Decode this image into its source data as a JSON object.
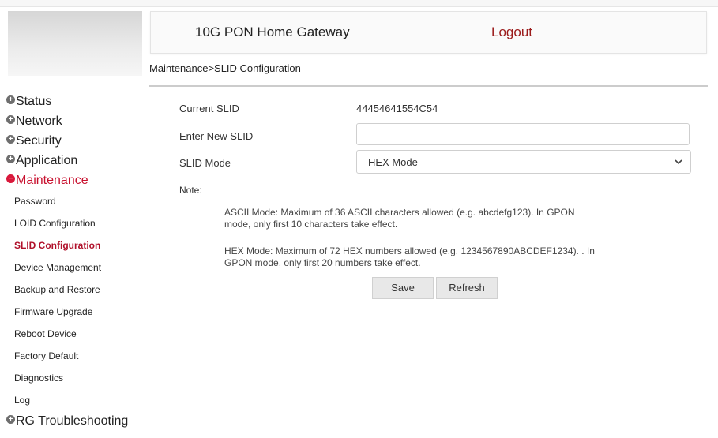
{
  "header": {
    "title": "10G PON Home Gateway",
    "logout": "Logout"
  },
  "breadcrumb": "Maintenance>SLID Configuration",
  "sidebar": {
    "groups_before": [
      {
        "label": "Status"
      },
      {
        "label": "Network"
      },
      {
        "label": "Security"
      },
      {
        "label": "Application"
      }
    ],
    "active_group": {
      "label": "Maintenance"
    },
    "items": [
      {
        "label": "Password"
      },
      {
        "label": "LOID Configuration"
      },
      {
        "label": "SLID Configuration"
      },
      {
        "label": "Device Management"
      },
      {
        "label": "Backup and Restore"
      },
      {
        "label": "Firmware Upgrade"
      },
      {
        "label": "Reboot Device"
      },
      {
        "label": "Factory Default"
      },
      {
        "label": "Diagnostics"
      },
      {
        "label": "Log"
      }
    ],
    "groups_after": [
      {
        "label": "RG Troubleshooting"
      }
    ]
  },
  "form": {
    "current_slid_label": "Current SLID",
    "current_slid_value": "44454641554C54",
    "new_slid_label": "Enter New SLID",
    "new_slid_value": "",
    "mode_label": "SLID Mode",
    "mode_selected": "HEX Mode",
    "note_label": "Note:",
    "note_ascii": "ASCII Mode: Maximum of 36 ASCII characters allowed (e.g. abcdefg123). In GPON mode, only first 10 characters take effect.",
    "note_hex": "HEX Mode: Maximum of 72 HEX numbers allowed (e.g. 1234567890ABCDEF1234). . In GPON mode, only first 20 numbers take effect.",
    "save_label": "Save",
    "refresh_label": "Refresh"
  },
  "colors": {
    "active_red": "#c8102e",
    "logout_red": "#9b1b1b"
  }
}
